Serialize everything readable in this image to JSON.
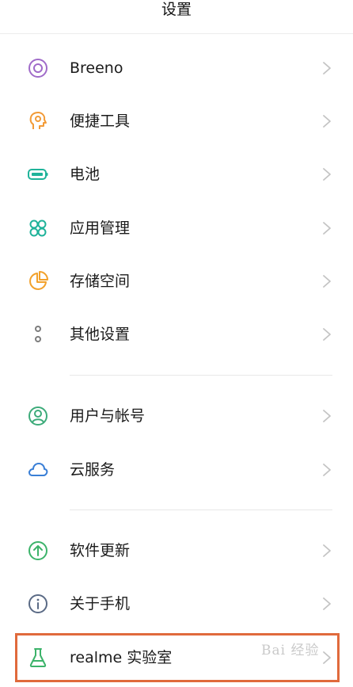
{
  "header": {
    "title": "设置"
  },
  "colors": {
    "breeno": "#a06bc9",
    "shortcut": "#f29b38",
    "battery": "#1fb39a",
    "apps": "#1fb39a",
    "storage": "#f2a12b",
    "more": "#7d7d7d",
    "account": "#3dab7a",
    "cloud": "#3a7fd6",
    "update": "#3cb36a",
    "about": "#5a6a85",
    "lab": "#3cb36a",
    "highlight": "#e06a3c"
  },
  "settings": {
    "items": [
      {
        "label": "Breeno",
        "icon": "breeno-icon"
      },
      {
        "label": "便捷工具",
        "icon": "shortcut-tools-icon"
      },
      {
        "label": "电池",
        "icon": "battery-icon"
      },
      {
        "label": "应用管理",
        "icon": "apps-grid-icon"
      },
      {
        "label": "存储空间",
        "icon": "storage-pie-icon"
      },
      {
        "label": "其他设置",
        "icon": "more-dots-icon"
      },
      {
        "label": "用户与帐号",
        "icon": "user-account-icon"
      },
      {
        "label": "云服务",
        "icon": "cloud-icon"
      },
      {
        "label": "软件更新",
        "icon": "software-update-icon"
      },
      {
        "label": "关于手机",
        "icon": "info-icon"
      },
      {
        "label": "realme 实验室",
        "icon": "flask-icon"
      }
    ]
  },
  "watermark": {
    "text": "Bai 经验"
  }
}
